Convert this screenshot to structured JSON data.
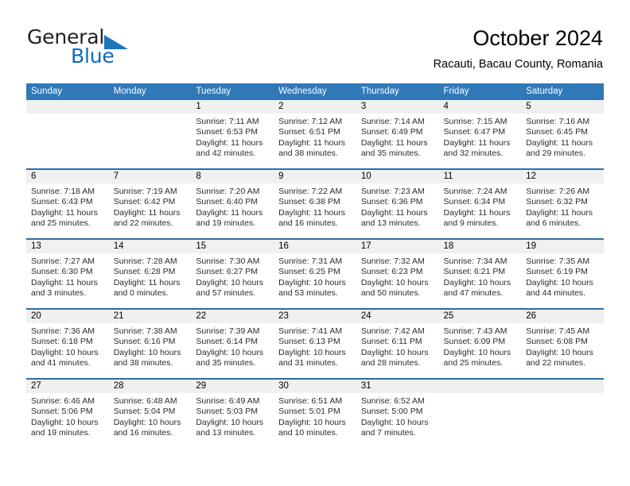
{
  "brand": {
    "word1": "General",
    "word2": "Blue",
    "triangle_color": "#1b76bc"
  },
  "header": {
    "title": "October 2024",
    "subtitle": "Racauti, Bacau County, Romania"
  },
  "colors": {
    "header_blue": "#3079b8",
    "row_divider_blue": "#2e6da4",
    "daynum_band": "#f0f0f0"
  },
  "weekday_headers": [
    "Sunday",
    "Monday",
    "Tuesday",
    "Wednesday",
    "Thursday",
    "Friday",
    "Saturday"
  ],
  "weeks": [
    [
      {
        "day": "",
        "sunrise": "",
        "sunset": "",
        "daylight1": "",
        "daylight2": ""
      },
      {
        "day": "",
        "sunrise": "",
        "sunset": "",
        "daylight1": "",
        "daylight2": ""
      },
      {
        "day": "1",
        "sunrise": "Sunrise: 7:11 AM",
        "sunset": "Sunset: 6:53 PM",
        "daylight1": "Daylight: 11 hours",
        "daylight2": "and 42 minutes."
      },
      {
        "day": "2",
        "sunrise": "Sunrise: 7:12 AM",
        "sunset": "Sunset: 6:51 PM",
        "daylight1": "Daylight: 11 hours",
        "daylight2": "and 38 minutes."
      },
      {
        "day": "3",
        "sunrise": "Sunrise: 7:14 AM",
        "sunset": "Sunset: 6:49 PM",
        "daylight1": "Daylight: 11 hours",
        "daylight2": "and 35 minutes."
      },
      {
        "day": "4",
        "sunrise": "Sunrise: 7:15 AM",
        "sunset": "Sunset: 6:47 PM",
        "daylight1": "Daylight: 11 hours",
        "daylight2": "and 32 minutes."
      },
      {
        "day": "5",
        "sunrise": "Sunrise: 7:16 AM",
        "sunset": "Sunset: 6:45 PM",
        "daylight1": "Daylight: 11 hours",
        "daylight2": "and 29 minutes."
      }
    ],
    [
      {
        "day": "6",
        "sunrise": "Sunrise: 7:18 AM",
        "sunset": "Sunset: 6:43 PM",
        "daylight1": "Daylight: 11 hours",
        "daylight2": "and 25 minutes."
      },
      {
        "day": "7",
        "sunrise": "Sunrise: 7:19 AM",
        "sunset": "Sunset: 6:42 PM",
        "daylight1": "Daylight: 11 hours",
        "daylight2": "and 22 minutes."
      },
      {
        "day": "8",
        "sunrise": "Sunrise: 7:20 AM",
        "sunset": "Sunset: 6:40 PM",
        "daylight1": "Daylight: 11 hours",
        "daylight2": "and 19 minutes."
      },
      {
        "day": "9",
        "sunrise": "Sunrise: 7:22 AM",
        "sunset": "Sunset: 6:38 PM",
        "daylight1": "Daylight: 11 hours",
        "daylight2": "and 16 minutes."
      },
      {
        "day": "10",
        "sunrise": "Sunrise: 7:23 AM",
        "sunset": "Sunset: 6:36 PM",
        "daylight1": "Daylight: 11 hours",
        "daylight2": "and 13 minutes."
      },
      {
        "day": "11",
        "sunrise": "Sunrise: 7:24 AM",
        "sunset": "Sunset: 6:34 PM",
        "daylight1": "Daylight: 11 hours",
        "daylight2": "and 9 minutes."
      },
      {
        "day": "12",
        "sunrise": "Sunrise: 7:26 AM",
        "sunset": "Sunset: 6:32 PM",
        "daylight1": "Daylight: 11 hours",
        "daylight2": "and 6 minutes."
      }
    ],
    [
      {
        "day": "13",
        "sunrise": "Sunrise: 7:27 AM",
        "sunset": "Sunset: 6:30 PM",
        "daylight1": "Daylight: 11 hours",
        "daylight2": "and 3 minutes."
      },
      {
        "day": "14",
        "sunrise": "Sunrise: 7:28 AM",
        "sunset": "Sunset: 6:28 PM",
        "daylight1": "Daylight: 11 hours",
        "daylight2": "and 0 minutes."
      },
      {
        "day": "15",
        "sunrise": "Sunrise: 7:30 AM",
        "sunset": "Sunset: 6:27 PM",
        "daylight1": "Daylight: 10 hours",
        "daylight2": "and 57 minutes."
      },
      {
        "day": "16",
        "sunrise": "Sunrise: 7:31 AM",
        "sunset": "Sunset: 6:25 PM",
        "daylight1": "Daylight: 10 hours",
        "daylight2": "and 53 minutes."
      },
      {
        "day": "17",
        "sunrise": "Sunrise: 7:32 AM",
        "sunset": "Sunset: 6:23 PM",
        "daylight1": "Daylight: 10 hours",
        "daylight2": "and 50 minutes."
      },
      {
        "day": "18",
        "sunrise": "Sunrise: 7:34 AM",
        "sunset": "Sunset: 6:21 PM",
        "daylight1": "Daylight: 10 hours",
        "daylight2": "and 47 minutes."
      },
      {
        "day": "19",
        "sunrise": "Sunrise: 7:35 AM",
        "sunset": "Sunset: 6:19 PM",
        "daylight1": "Daylight: 10 hours",
        "daylight2": "and 44 minutes."
      }
    ],
    [
      {
        "day": "20",
        "sunrise": "Sunrise: 7:36 AM",
        "sunset": "Sunset: 6:18 PM",
        "daylight1": "Daylight: 10 hours",
        "daylight2": "and 41 minutes."
      },
      {
        "day": "21",
        "sunrise": "Sunrise: 7:38 AM",
        "sunset": "Sunset: 6:16 PM",
        "daylight1": "Daylight: 10 hours",
        "daylight2": "and 38 minutes."
      },
      {
        "day": "22",
        "sunrise": "Sunrise: 7:39 AM",
        "sunset": "Sunset: 6:14 PM",
        "daylight1": "Daylight: 10 hours",
        "daylight2": "and 35 minutes."
      },
      {
        "day": "23",
        "sunrise": "Sunrise: 7:41 AM",
        "sunset": "Sunset: 6:13 PM",
        "daylight1": "Daylight: 10 hours",
        "daylight2": "and 31 minutes."
      },
      {
        "day": "24",
        "sunrise": "Sunrise: 7:42 AM",
        "sunset": "Sunset: 6:11 PM",
        "daylight1": "Daylight: 10 hours",
        "daylight2": "and 28 minutes."
      },
      {
        "day": "25",
        "sunrise": "Sunrise: 7:43 AM",
        "sunset": "Sunset: 6:09 PM",
        "daylight1": "Daylight: 10 hours",
        "daylight2": "and 25 minutes."
      },
      {
        "day": "26",
        "sunrise": "Sunrise: 7:45 AM",
        "sunset": "Sunset: 6:08 PM",
        "daylight1": "Daylight: 10 hours",
        "daylight2": "and 22 minutes."
      }
    ],
    [
      {
        "day": "27",
        "sunrise": "Sunrise: 6:46 AM",
        "sunset": "Sunset: 5:06 PM",
        "daylight1": "Daylight: 10 hours",
        "daylight2": "and 19 minutes."
      },
      {
        "day": "28",
        "sunrise": "Sunrise: 6:48 AM",
        "sunset": "Sunset: 5:04 PM",
        "daylight1": "Daylight: 10 hours",
        "daylight2": "and 16 minutes."
      },
      {
        "day": "29",
        "sunrise": "Sunrise: 6:49 AM",
        "sunset": "Sunset: 5:03 PM",
        "daylight1": "Daylight: 10 hours",
        "daylight2": "and 13 minutes."
      },
      {
        "day": "30",
        "sunrise": "Sunrise: 6:51 AM",
        "sunset": "Sunset: 5:01 PM",
        "daylight1": "Daylight: 10 hours",
        "daylight2": "and 10 minutes."
      },
      {
        "day": "31",
        "sunrise": "Sunrise: 6:52 AM",
        "sunset": "Sunset: 5:00 PM",
        "daylight1": "Daylight: 10 hours",
        "daylight2": "and 7 minutes."
      },
      {
        "day": "",
        "sunrise": "",
        "sunset": "",
        "daylight1": "",
        "daylight2": ""
      },
      {
        "day": "",
        "sunrise": "",
        "sunset": "",
        "daylight1": "",
        "daylight2": ""
      }
    ]
  ]
}
